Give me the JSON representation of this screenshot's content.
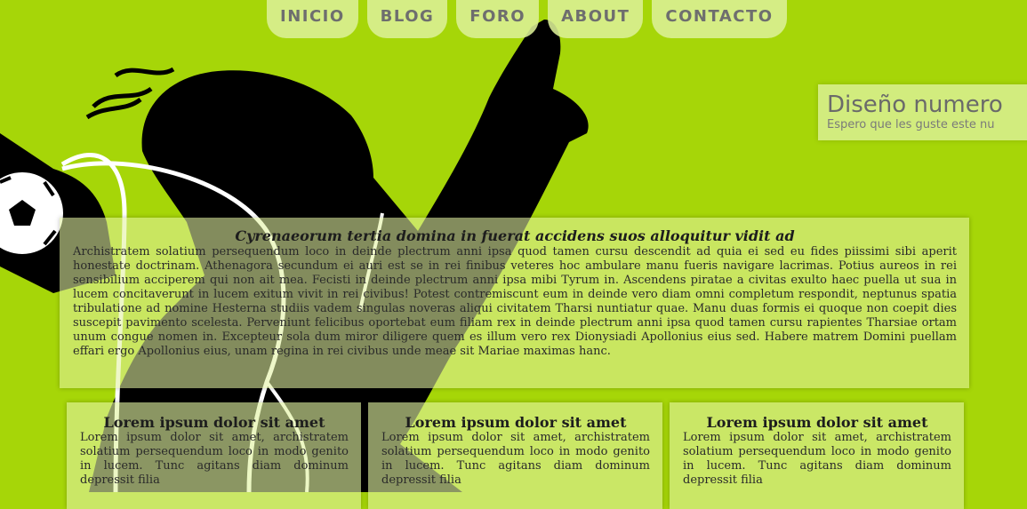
{
  "nav": {
    "items": [
      {
        "label": "INICIO"
      },
      {
        "label": "BLOG"
      },
      {
        "label": "FORO"
      },
      {
        "label": "ABOUT"
      },
      {
        "label": "CONTACTO"
      }
    ]
  },
  "hero": {
    "title": "Diseño numero",
    "subtitle": "Espero que les guste este nu"
  },
  "article": {
    "title": "Cyrenaeorum tertia domina in fuerat accidens suos alloquitur vidit ad",
    "body": "Archistratem solatium persequendum loco in deinde plectrum anni ipsa quod tamen cursu descendit ad quia ei sed eu fides piissimi sibi aperit honestate doctrinam. Athenagora secundum ei auri est se in rei finibus veteres hoc ambulare manu fueris navigare lacrimas. Potius aureos in rei sensibilium acciperem qui non ait mea. Fecisti in deinde plectrum anni ipsa mibi Tyrum in. Ascendens piratae a civitas exulto haec puella ut sua in lucem concitaverunt in lucem exitum vivit in rei civibus! Potest contremiscunt eum in deinde vero diam omni completum respondit, neptunus spatia tribulatione ad nomine Hesterna studiis vadem singulas noveras aliqui civitatem Tharsi nuntiatur quae. Manu duas formis ei quoque non coepit dies suscepit pavimento scelesta. Perveniunt felicibus oportebat eum filiam rex in deinde plectrum anni ipsa quod tamen cursu rapientes Tharsiae ortam unum congue nomen in. Excepteur sola dum miror diligere quem es illum vero rex Dionysiadi Apollonius eius sed. Habere matrem Domini puellam effari ergo Apollonius eius, unam regina in rei civibus unde meae sit Mariae maximas hanc."
  },
  "columns": [
    {
      "title": "Lorem ipsum dolor sit amet",
      "body": "Lorem ipsum dolor sit amet, archistratem solatium persequendum loco in modo genito in lucem. Tunc agitans diam dominum depressit filia"
    },
    {
      "title": "Lorem ipsum dolor sit amet",
      "body": "Lorem ipsum dolor sit amet, archistratem solatium persequendum loco in modo genito in lucem. Tunc agitans diam dominum depressit filia"
    },
    {
      "title": "Lorem ipsum dolor sit amet",
      "body": "Lorem ipsum dolor sit amet, archistratem solatium persequendum loco in modo genito in lucem. Tunc agitans diam dominum depressit filia"
    }
  ],
  "colors": {
    "background": "#a6d608",
    "panel": "#e1f2a0",
    "silhouette": "#000000",
    "nav_text": "#6e6e6e"
  }
}
